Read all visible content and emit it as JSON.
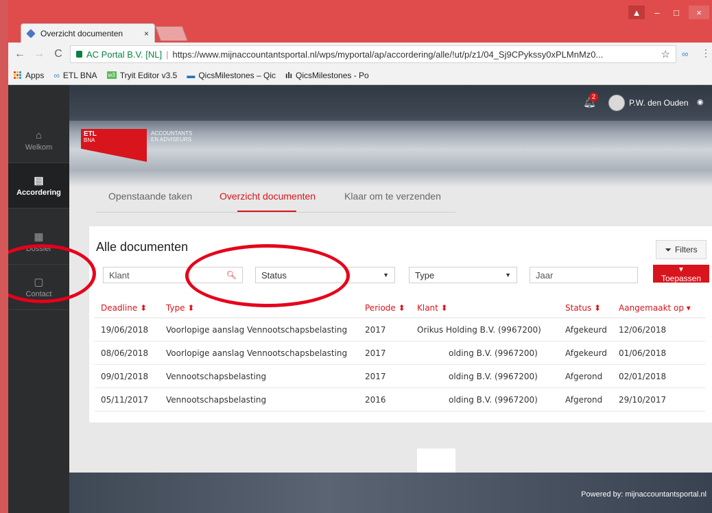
{
  "browser": {
    "tab_title": "Overzicht documenten",
    "tab_close": "×",
    "nav": {
      "back": "←",
      "forward": "→",
      "reload": "C"
    },
    "secure_label": "AC Portal B.V. [NL]",
    "url": "https://www.mijnaccountantsportal.nl/wps/myportal/ap/accordering/alle/!ut/p/z1/04_Sj9CPykssy0xPLMnMz0...",
    "bookmarks": [
      {
        "label": "Apps",
        "icon": "apps-grid-icon"
      },
      {
        "label": "ETL BNA",
        "icon": "glasses-icon"
      },
      {
        "label": "Tryit Editor v3.5",
        "icon": "w3-icon"
      },
      {
        "label": "QicsMilestones – Qic",
        "icon": "monitor-icon"
      },
      {
        "label": "QicsMilestones - Po",
        "icon": "bar-chart-icon"
      }
    ]
  },
  "header": {
    "notification_count": "2",
    "user_name": "P.W. den Ouden"
  },
  "logo": {
    "brand_line1": "ETL",
    "brand_line2": "BNA",
    "tagline_1": "ACCOUNTANTS",
    "tagline_2": "EN ADVISEURS"
  },
  "sidebar": {
    "items": [
      {
        "label": "Welkom",
        "icon": "home-icon"
      },
      {
        "label": "Accordering",
        "icon": "document-icon"
      },
      {
        "label": "Dossier",
        "icon": "dossier-icon"
      },
      {
        "label": "Contact",
        "icon": "chat-icon"
      }
    ]
  },
  "tabs": [
    {
      "label": "Openstaande taken"
    },
    {
      "label": "Overzicht documenten"
    },
    {
      "label": "Klaar om te verzenden"
    }
  ],
  "card": {
    "title": "Alle documenten",
    "filters_label": "Filters",
    "search_placeholder": "Klant",
    "status_select": "Status",
    "type_select": "Type",
    "jaar_placeholder": "Jaar",
    "apply_label": "Toepassen"
  },
  "table": {
    "headers": [
      "Deadline ⬍",
      "Type ⬍",
      "Periode ⬍",
      "Klant ⬍",
      "Status ⬍",
      "Aangemaakt op ▾"
    ],
    "rows": [
      [
        "19/06/2018",
        "Voorlopige aanslag Vennootschapsbelasting",
        "2017",
        "Orikus Holding B.V. (9967200)",
        "Afgekeurd",
        "12/06/2018"
      ],
      [
        "08/06/2018",
        "Voorlopige aanslag Vennootschapsbelasting",
        "2017",
        "olding B.V. (9967200)",
        "Afgekeurd",
        "01/06/2018"
      ],
      [
        "09/01/2018",
        "Vennootschapsbelasting",
        "2017",
        "olding B.V. (9967200)",
        "Afgerond",
        "02/01/2018"
      ],
      [
        "05/11/2017",
        "Vennootschapsbelasting",
        "2016",
        "olding B.V. (9967200)",
        "Afgerond",
        "29/10/2017"
      ]
    ]
  },
  "footer": {
    "powered_by": "Powered by: mijnaccountantsportal.nl"
  },
  "colors": {
    "accent_red": "#d8141c",
    "sidebar_bg": "#2b2d2f",
    "annotation_red": "#e6001a"
  }
}
